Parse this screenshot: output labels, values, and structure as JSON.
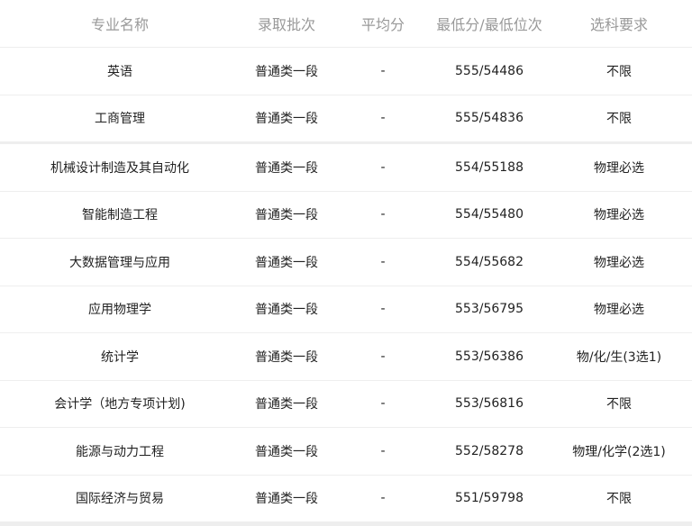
{
  "headers": [
    "专业名称",
    "录取批次",
    "平均分",
    "最低分/最低位次",
    "选科要求"
  ],
  "rows": [
    {
      "major": "英语",
      "batch": "普通类一段",
      "avg": "-",
      "min": "555/54486",
      "req": "不限"
    },
    {
      "major": "工商管理",
      "batch": "普通类一段",
      "avg": "-",
      "min": "555/54836",
      "req": "不限"
    },
    {
      "major": "机械设计制造及其自动化",
      "batch": "普通类一段",
      "avg": "-",
      "min": "554/55188",
      "req": "物理必选"
    },
    {
      "major": "智能制造工程",
      "batch": "普通类一段",
      "avg": "-",
      "min": "554/55480",
      "req": "物理必选"
    },
    {
      "major": "大数据管理与应用",
      "batch": "普通类一段",
      "avg": "-",
      "min": "554/55682",
      "req": "物理必选"
    },
    {
      "major": "应用物理学",
      "batch": "普通类一段",
      "avg": "-",
      "min": "553/56795",
      "req": "物理必选"
    },
    {
      "major": "统计学",
      "batch": "普通类一段",
      "avg": "-",
      "min": "553/56386",
      "req": "物/化/生(3选1)"
    },
    {
      "major": "会计学（地方专项计划)",
      "batch": "普通类一段",
      "avg": "-",
      "min": "553/56816",
      "req": "不限"
    },
    {
      "major": "能源与动力工程",
      "batch": "普通类一段",
      "avg": "-",
      "min": "552/58278",
      "req": "物理/化学(2选1)"
    },
    {
      "major": "国际经济与贸易",
      "batch": "普通类一段",
      "avg": "-",
      "min": "551/59798",
      "req": "不限"
    }
  ]
}
